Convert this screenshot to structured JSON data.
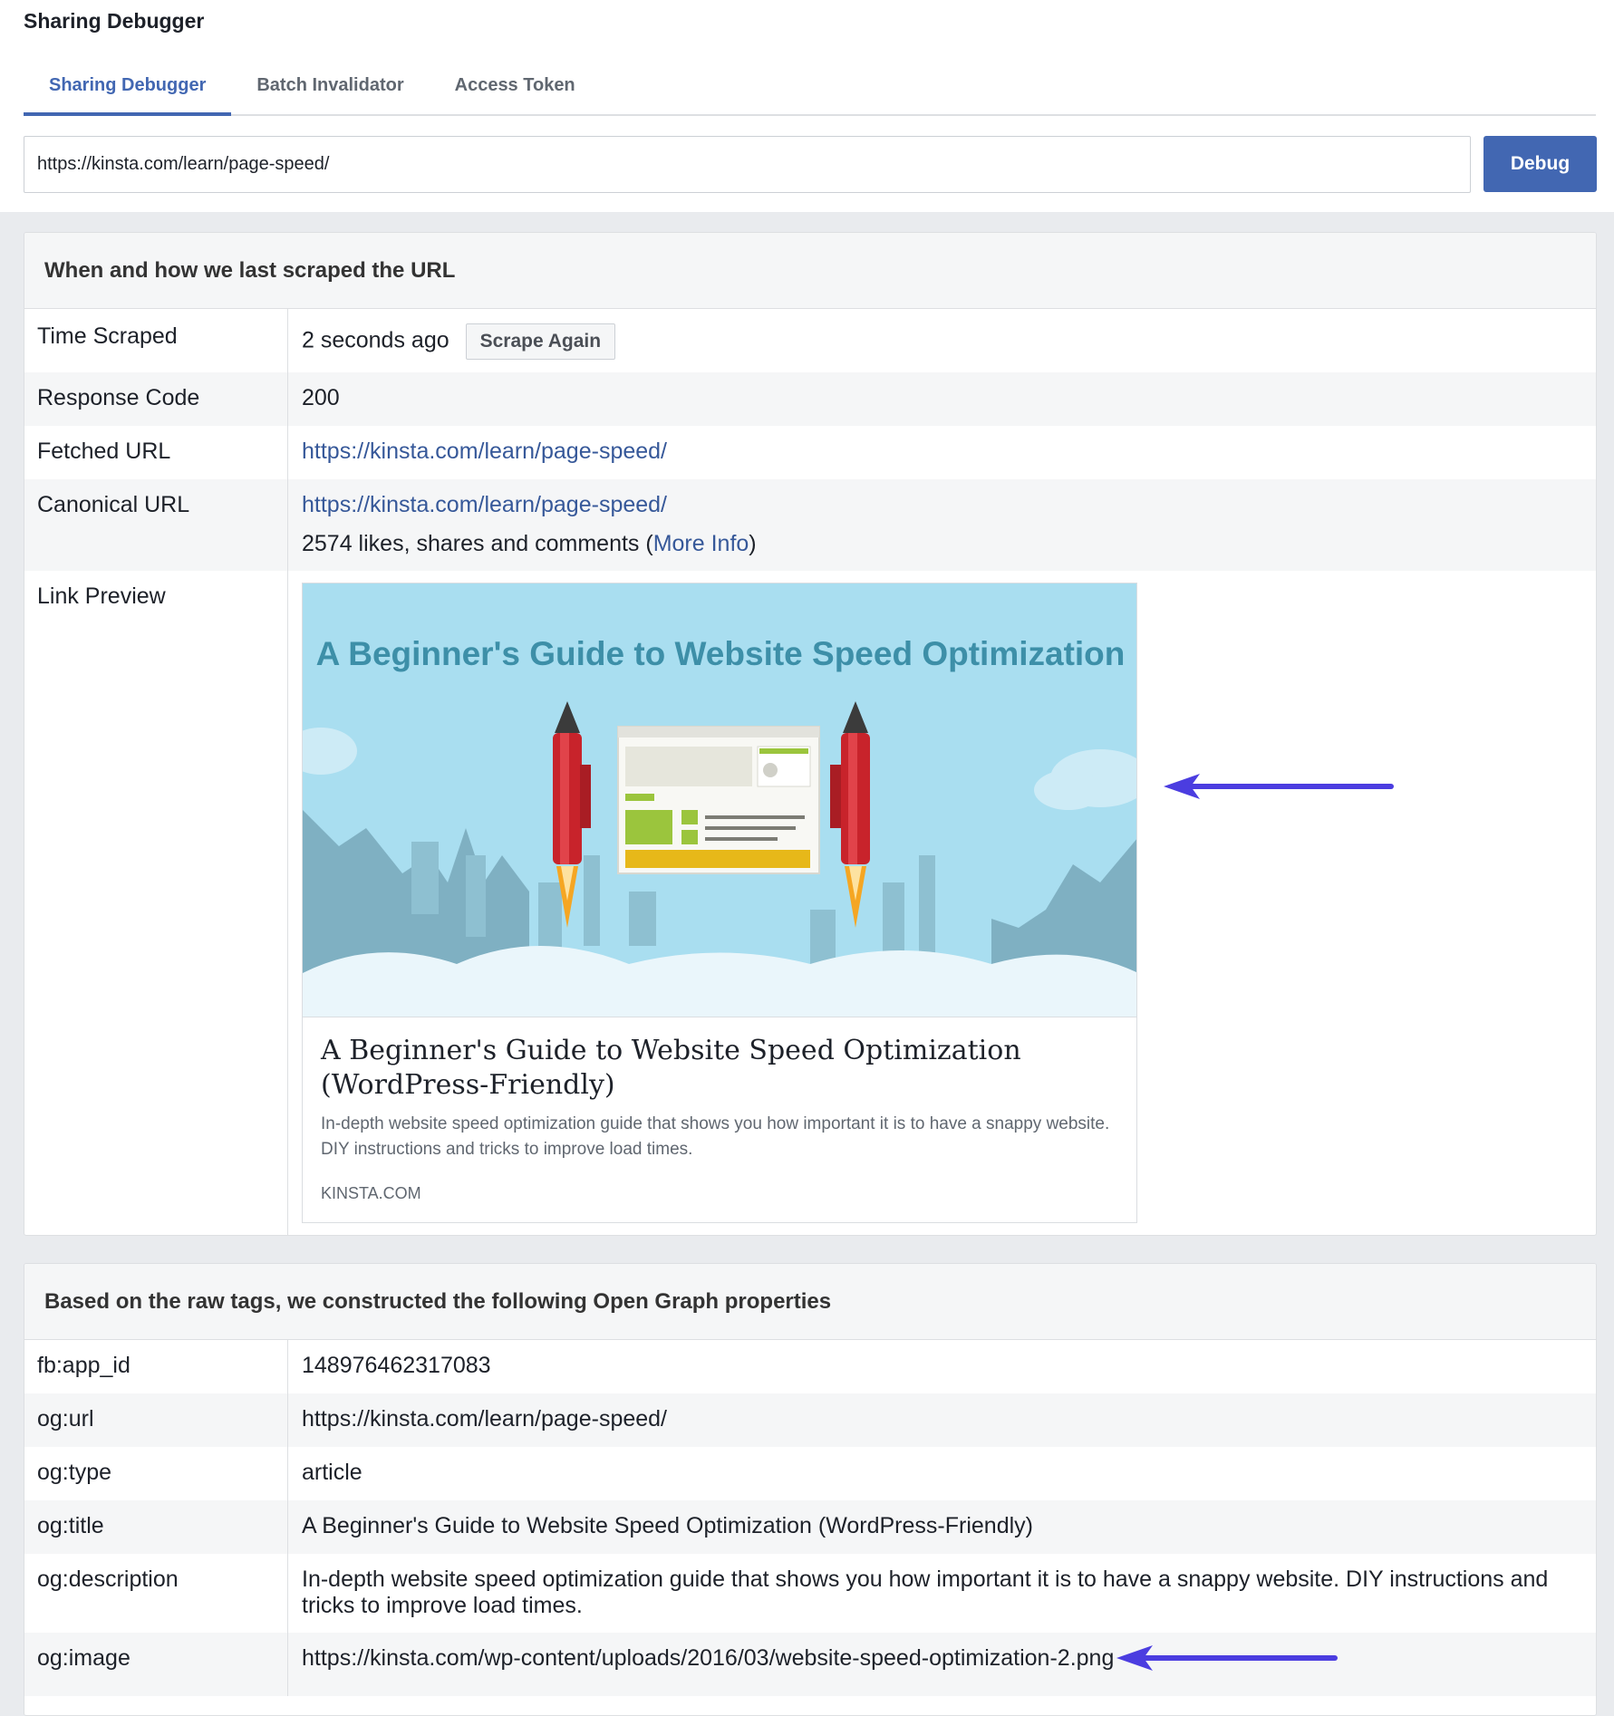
{
  "app": {
    "title": "Sharing Debugger"
  },
  "tabs": [
    {
      "label": "Sharing Debugger"
    },
    {
      "label": "Batch Invalidator"
    },
    {
      "label": "Access Token"
    }
  ],
  "search": {
    "value": "https://kinsta.com/learn/page-speed/"
  },
  "debug_button": "Debug",
  "scrape_section": {
    "header": "When and how we last scraped the URL",
    "time_scraped": {
      "label": "Time Scraped",
      "value": "2 seconds ago",
      "button": "Scrape Again"
    },
    "response_code": {
      "label": "Response Code",
      "value": "200"
    },
    "fetched_url": {
      "label": "Fetched URL",
      "value": "https://kinsta.com/learn/page-speed/"
    },
    "canonical_url": {
      "label": "Canonical URL",
      "value": "https://kinsta.com/learn/page-speed/",
      "engagement_text": "2574 likes, shares and comments (",
      "more_info": "More Info",
      "engagement_close": ")"
    },
    "link_preview": {
      "label": "Link Preview",
      "image_title": "A Beginner's Guide to Website Speed Optimization",
      "title": "A Beginner's Guide to Website Speed Optimization (WordPress-Friendly)",
      "description": "In-depth website speed optimization guide that shows you how important it is to have a snappy website. DIY instructions and tricks to improve load times.",
      "domain": "KINSTA.COM"
    }
  },
  "og_section": {
    "header": "Based on the raw tags, we constructed the following Open Graph properties",
    "rows": [
      {
        "key": "fb:app_id",
        "value": "148976462317083"
      },
      {
        "key": "og:url",
        "value": "https://kinsta.com/learn/page-speed/"
      },
      {
        "key": "og:type",
        "value": "article"
      },
      {
        "key": "og:title",
        "value": "A Beginner's Guide to Website Speed Optimization (WordPress-Friendly)"
      },
      {
        "key": "og:description",
        "value": "In-depth website speed optimization guide that shows you how important it is to have a snappy website. DIY instructions and tricks to improve load times."
      },
      {
        "key": "og:image",
        "value": "https://kinsta.com/wp-content/uploads/2016/03/website-speed-optimization-2.png"
      }
    ]
  },
  "colors": {
    "accent": "#4267b2",
    "link": "#365899",
    "annotation_arrow": "#4b3de0",
    "image_sky": "#a9def0",
    "rocket_red": "#c8232b"
  }
}
